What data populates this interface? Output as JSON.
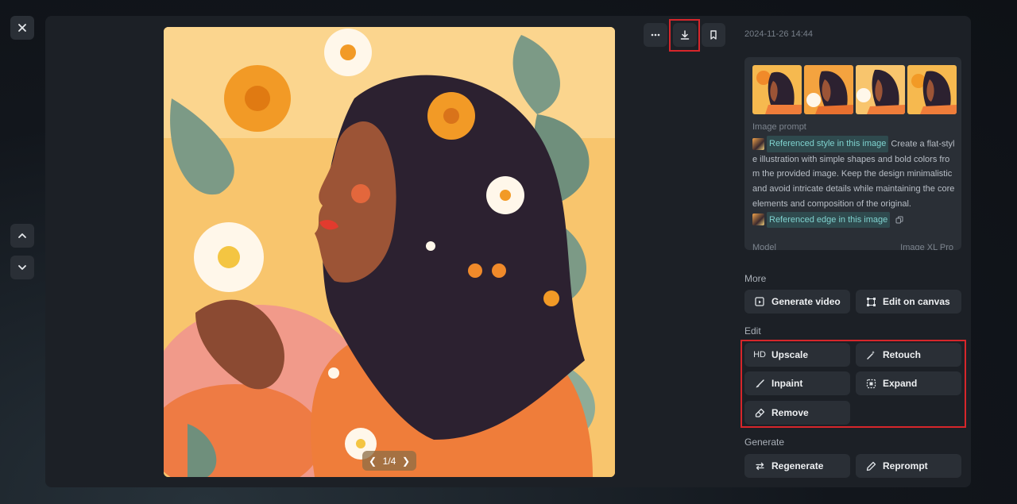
{
  "viewer": {
    "pager": {
      "label": "1/4"
    }
  },
  "icons": {
    "close": "close-icon",
    "nav_up": "chevron-up-icon",
    "nav_down": "chevron-down-icon",
    "more": "more-icon",
    "download": "download-icon",
    "bookmark": "bookmark-icon"
  },
  "details": {
    "timestamp": "2024-11-26 14:44",
    "prompt_label": "Image prompt",
    "ref_style": "Referenced style in this image",
    "prompt_body": " Create a flat-style illustration with simple shapes and bold colors from the provided image. Keep the design minimalistic and avoid intricate details while maintaining the core elements and composition of the original.",
    "ref_edge": "Referenced edge in this image",
    "model_label": "Model",
    "model_value": "Image XL Pro"
  },
  "sections": {
    "more": {
      "title": "More",
      "buttons": [
        {
          "label": "Generate video",
          "icon": "generate-video-icon"
        },
        {
          "label": "Edit on canvas",
          "icon": "canvas-icon"
        }
      ]
    },
    "edit": {
      "title": "Edit",
      "buttons": [
        {
          "label": "Upscale",
          "icon": "HD"
        },
        {
          "label": "Retouch",
          "icon": "magic-wand-icon"
        },
        {
          "label": "Inpaint",
          "icon": "brush-icon"
        },
        {
          "label": "Expand",
          "icon": "expand-icon"
        },
        {
          "label": "Remove",
          "icon": "eraser-icon"
        }
      ]
    },
    "generate": {
      "title": "Generate",
      "buttons": [
        {
          "label": "Regenerate",
          "icon": "regenerate-icon"
        },
        {
          "label": "Reprompt",
          "icon": "pencil-icon"
        }
      ]
    }
  },
  "colors": {
    "accent_highlight": "#d7262b",
    "ref_chip_bg": "#2f4a4e",
    "ref_chip_text": "#7fd2cf"
  }
}
